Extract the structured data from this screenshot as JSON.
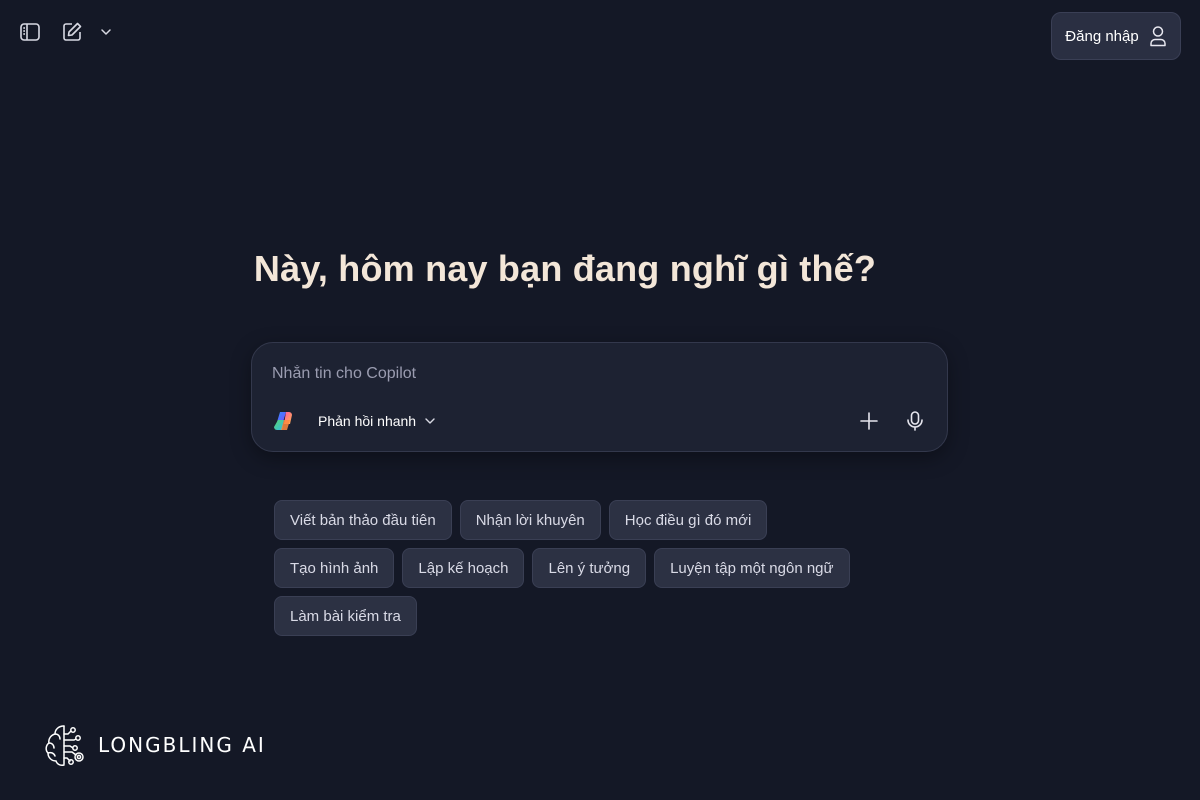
{
  "header": {
    "login_label": "Đăng nhập"
  },
  "main": {
    "headline": "Này, hôm nay bạn đang nghĩ gì thế?"
  },
  "composer": {
    "placeholder": "Nhắn tin cho Copilot",
    "value": "",
    "mode_label": "Phản hồi nhanh"
  },
  "suggestions": [
    "Viết bản thảo đầu tiên",
    "Nhận lời khuyên",
    "Học điều gì đó mới",
    "Tạo hình ảnh",
    "Lập kế hoạch",
    "Lên ý tưởng",
    "Luyện tập một ngôn ngữ",
    "Làm bài kiểm tra"
  ],
  "brand": {
    "name": "LONGBLING AI"
  },
  "icons": {
    "sidebar": "sidebar-icon",
    "new_chat": "compose-icon",
    "dropdown": "chevron-down-icon",
    "user": "user-icon",
    "copilot": "copilot-logo-icon",
    "add": "plus-icon",
    "mic": "microphone-icon",
    "brand": "brain-circuit-icon"
  },
  "colors": {
    "background": "#141826",
    "headline": "#f3e6d8",
    "chip_bg": "#2c3143",
    "composer_bg": "#1d2232"
  }
}
